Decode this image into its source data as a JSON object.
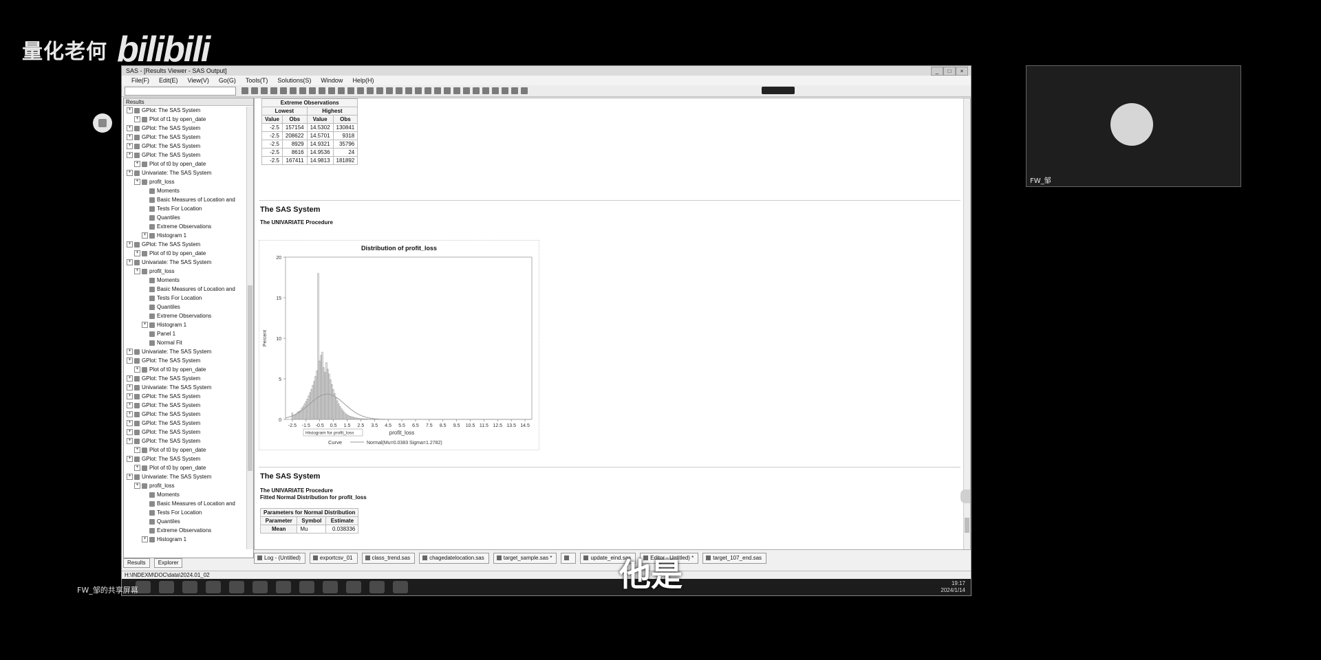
{
  "watermark": {
    "channel": "量化老何",
    "logo": "bilibili"
  },
  "window": {
    "title": "SAS - [Results Viewer - SAS Output]",
    "menu": [
      "File(F)",
      "Edit(E)",
      "View(V)",
      "Go(G)",
      "Tools(T)",
      "Solutions(S)",
      "Window",
      "Help(H)"
    ]
  },
  "results_pane": {
    "header": "Results",
    "tree": [
      {
        "label": "GPlot: The SAS System",
        "level": 0,
        "icon": "folder-icon"
      },
      {
        "label": "Plot of t1 by open_date",
        "level": 1,
        "icon": "graph-icon"
      },
      {
        "label": "GPlot: The SAS System",
        "level": 0,
        "icon": "folder-icon"
      },
      {
        "label": "GPlot: The SAS System",
        "level": 0,
        "icon": "folder-icon"
      },
      {
        "label": "GPlot: The SAS System",
        "level": 0,
        "icon": "folder-icon"
      },
      {
        "label": "GPlot: The SAS System",
        "level": 0,
        "icon": "folder-icon"
      },
      {
        "label": "Plot of t0 by open_date",
        "level": 1,
        "icon": "graph-icon"
      },
      {
        "label": "Univariate: The SAS System",
        "level": 0,
        "icon": "folder-icon"
      },
      {
        "label": "profit_loss",
        "level": 1,
        "icon": "folder-icon"
      },
      {
        "label": "Moments",
        "level": 2,
        "icon": "table-icon"
      },
      {
        "label": "Basic Measures of Location and",
        "level": 2,
        "icon": "table-icon"
      },
      {
        "label": "Tests For Location",
        "level": 2,
        "icon": "table-icon"
      },
      {
        "label": "Quantiles",
        "level": 2,
        "icon": "table-icon"
      },
      {
        "label": "Extreme Observations",
        "level": 2,
        "icon": "table-icon"
      },
      {
        "label": "Histogram 1",
        "level": 2,
        "icon": "folder-icon"
      },
      {
        "label": "GPlot: The SAS System",
        "level": 0,
        "icon": "folder-icon"
      },
      {
        "label": "Plot of t0 by open_date",
        "level": 1,
        "icon": "graph-icon"
      },
      {
        "label": "Univariate: The SAS System",
        "level": 0,
        "icon": "folder-icon"
      },
      {
        "label": "profit_loss",
        "level": 1,
        "icon": "folder-icon"
      },
      {
        "label": "Moments",
        "level": 2,
        "icon": "table-icon"
      },
      {
        "label": "Basic Measures of Location and",
        "level": 2,
        "icon": "table-icon"
      },
      {
        "label": "Tests For Location",
        "level": 2,
        "icon": "table-icon"
      },
      {
        "label": "Quantiles",
        "level": 2,
        "icon": "table-icon"
      },
      {
        "label": "Extreme Observations",
        "level": 2,
        "icon": "table-icon"
      },
      {
        "label": "Histogram 1",
        "level": 2,
        "icon": "folder-icon"
      },
      {
        "label": "Panel 1",
        "level": 3,
        "icon": "graph-icon"
      },
      {
        "label": "Normal Fit",
        "level": 3,
        "icon": "folder-icon"
      },
      {
        "label": "Univariate: The SAS System",
        "level": 0,
        "icon": "folder-icon"
      },
      {
        "label": "GPlot: The SAS System",
        "level": 0,
        "icon": "folder-icon"
      },
      {
        "label": "Plot of t0 by open_date",
        "level": 1,
        "icon": "graph-icon"
      },
      {
        "label": "GPlot: The SAS System",
        "level": 0,
        "icon": "folder-icon"
      },
      {
        "label": "Univariate: The SAS System",
        "level": 0,
        "icon": "folder-icon"
      },
      {
        "label": "GPlot: The SAS System",
        "level": 0,
        "icon": "folder-icon"
      },
      {
        "label": "GPlot: The SAS System",
        "level": 0,
        "icon": "folder-icon"
      },
      {
        "label": "GPlot: The SAS System",
        "level": 0,
        "icon": "folder-icon"
      },
      {
        "label": "GPlot: The SAS System",
        "level": 0,
        "icon": "folder-icon"
      },
      {
        "label": "GPlot: The SAS System",
        "level": 0,
        "icon": "folder-icon"
      },
      {
        "label": "GPlot: The SAS System",
        "level": 0,
        "icon": "folder-icon"
      },
      {
        "label": "Plot of t0 by open_date",
        "level": 1,
        "icon": "graph-icon"
      },
      {
        "label": "GPlot: The SAS System",
        "level": 0,
        "icon": "folder-icon"
      },
      {
        "label": "Plot of t0 by open_date",
        "level": 1,
        "icon": "graph-icon"
      },
      {
        "label": "Univariate: The SAS System",
        "level": 0,
        "icon": "folder-icon"
      },
      {
        "label": "profit_loss",
        "level": 1,
        "icon": "folder-icon"
      },
      {
        "label": "Moments",
        "level": 2,
        "icon": "table-icon"
      },
      {
        "label": "Basic Measures of Location and",
        "level": 2,
        "icon": "table-icon"
      },
      {
        "label": "Tests For Location",
        "level": 2,
        "icon": "table-icon"
      },
      {
        "label": "Quantiles",
        "level": 2,
        "icon": "table-icon"
      },
      {
        "label": "Extreme Observations",
        "level": 2,
        "icon": "table-icon"
      },
      {
        "label": "Histogram 1",
        "level": 2,
        "icon": "folder-icon"
      }
    ],
    "tabs": [
      "Results",
      "Explorer"
    ]
  },
  "output": {
    "extreme": {
      "title": "Extreme Observations",
      "group_headers": [
        "Lowest",
        "Highest"
      ],
      "col_headers": [
        "Value",
        "Obs",
        "Value",
        "Obs"
      ],
      "rows": [
        [
          "-2.5",
          "157154",
          "14.5302",
          "130841"
        ],
        [
          "-2.5",
          "208622",
          "14.5701",
          "9318"
        ],
        [
          "-2.5",
          "8929",
          "14.9321",
          "35796"
        ],
        [
          "-2.5",
          "8616",
          "14.9536",
          "24"
        ],
        [
          "-2.5",
          "167411",
          "14.9813",
          "181892"
        ]
      ]
    },
    "section1": {
      "title": "The SAS System",
      "subtitle": "The UNIVARIATE Procedure"
    },
    "section2": {
      "title": "The SAS System",
      "subtitle": "The UNIVARIATE Procedure",
      "subtitle2": "Fitted Normal Distribution for profit_loss"
    },
    "params": {
      "title": "Parameters for Normal Distribution",
      "headers": [
        "Parameter",
        "Symbol",
        "Estimate"
      ],
      "rows": [
        [
          "Mean",
          "Mu",
          "0.038336"
        ]
      ]
    }
  },
  "chart_data": {
    "type": "bar",
    "title": "Distribution of profit_loss",
    "xlabel": "profit_loss",
    "ylabel": "Percent",
    "xlim": [
      -3,
      15
    ],
    "ylim": [
      0,
      20
    ],
    "x_ticks": [
      "-2.5",
      "-1.5",
      "-0.5",
      "0.5",
      "1.5",
      "2.5",
      "3.5",
      "4.5",
      "5.5",
      "6.5",
      "7.5",
      "8.5",
      "9.5",
      "10.5",
      "11.5",
      "12.5",
      "13.5",
      "14.5"
    ],
    "y_ticks": [
      "0",
      "5",
      "10",
      "15",
      "20"
    ],
    "bin_width": 0.1,
    "bins_x": [
      -2.5,
      -2.4,
      -2.3,
      -2.2,
      -2.1,
      -2.0,
      -1.9,
      -1.8,
      -1.7,
      -1.6,
      -1.5,
      -1.4,
      -1.3,
      -1.2,
      -1.1,
      -1.0,
      -0.9,
      -0.8,
      -0.7,
      -0.6,
      -0.5,
      -0.4,
      -0.3,
      -0.2,
      -0.1,
      0.0,
      0.1,
      0.2,
      0.3,
      0.4,
      0.5,
      0.6,
      0.7,
      0.8,
      0.9,
      1.0,
      1.1,
      1.2,
      1.3,
      1.4,
      1.5,
      1.6,
      1.7,
      1.8,
      1.9,
      2.0,
      2.1,
      2.2,
      2.3,
      2.4,
      2.5,
      2.6,
      2.7,
      2.8,
      2.9,
      3.0,
      3.2,
      3.4,
      3.6,
      3.8
    ],
    "bins_y": [
      0.8,
      0.5,
      0.6,
      0.7,
      0.9,
      1.0,
      1.1,
      1.4,
      1.6,
      1.9,
      2.2,
      2.5,
      2.9,
      3.3,
      3.7,
      4.2,
      4.7,
      5.3,
      6.0,
      18.0,
      7.2,
      7.9,
      8.3,
      6.4,
      5.8,
      7.0,
      6.2,
      5.6,
      4.9,
      4.3,
      3.7,
      3.2,
      2.7,
      2.3,
      1.9,
      1.6,
      1.3,
      1.1,
      0.9,
      0.7,
      0.6,
      0.5,
      0.4,
      0.35,
      0.3,
      0.25,
      0.2,
      0.18,
      0.15,
      0.12,
      0.1,
      0.09,
      0.08,
      0.07,
      0.06,
      0.05,
      0.04,
      0.03,
      0.02,
      0.02
    ],
    "series": [
      {
        "name": "Normal(Mu=0.0383 Sigma=1.2782)",
        "type": "normal_curve",
        "mu": 0.0383,
        "sigma": 1.2782
      }
    ],
    "legend_title": "Curve",
    "legend_position": "bottom",
    "tooltip": "Histogram for profit_loss"
  },
  "editor_tabs": [
    "Log - (Untitled)",
    "exportcsv_01",
    "class_trend.sas",
    "chagedatelocation.sas",
    "target_sample.sas *",
    "",
    "update_eind.sas",
    "Editor - Untitled) *",
    "target_107_end.sas"
  ],
  "status_bar": "H:\\INDEXM\\DOC\\data\\2024.01_02",
  "taskbar": {
    "time": "19:17",
    "date": "2024/1/14"
  },
  "subtitle": "他是",
  "share_caption": "FW_邹的共享屏幕",
  "video": {
    "name": "FW_邹"
  }
}
